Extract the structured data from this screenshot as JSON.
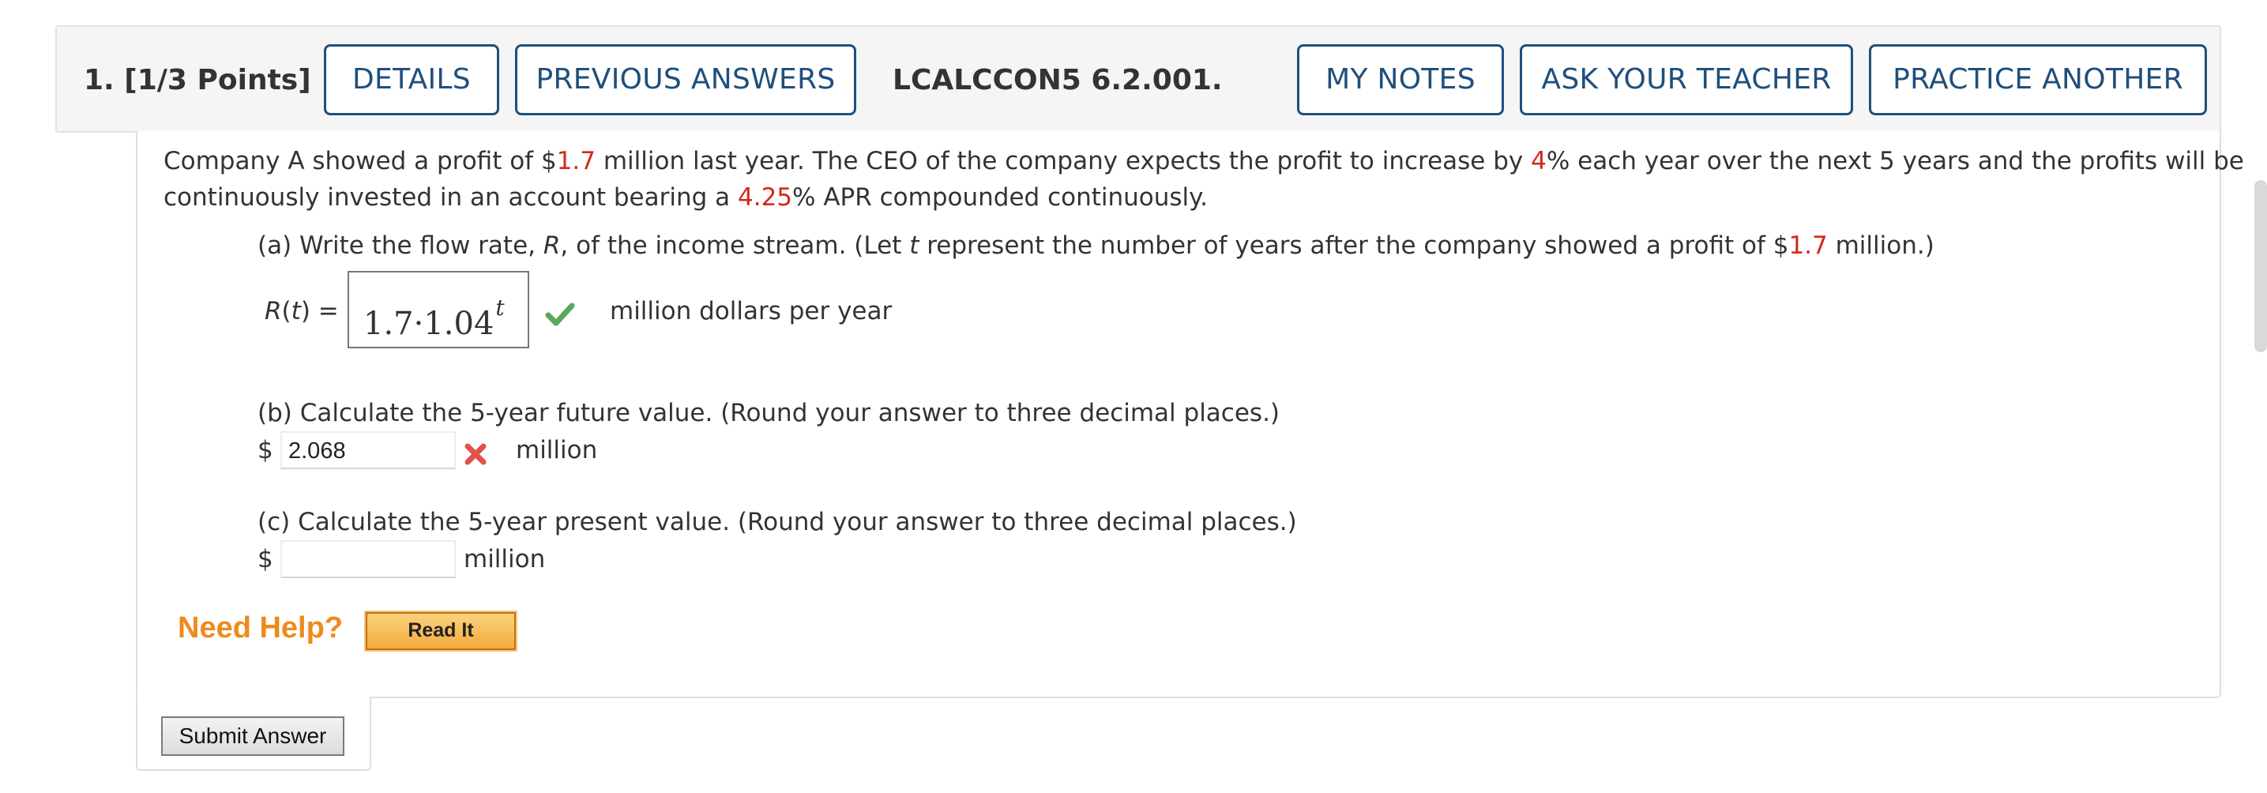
{
  "header": {
    "question_number": "1.",
    "points": "[1/3 Points]",
    "details_label": "DETAILS",
    "previous_answers_label": "PREVIOUS ANSWERS",
    "problem_code": "LCALCCON5 6.2.001.",
    "my_notes_label": "MY NOTES",
    "ask_teacher_label": "ASK YOUR TEACHER",
    "practice_another_label": "PRACTICE ANOTHER",
    "button_color": "#1f4f7d"
  },
  "intro": {
    "t1": "Company A showed a profit of $",
    "profit": "1.7",
    "t2": " million last year. The CEO of the company expects the profit to increase by ",
    "rate": "4",
    "t3": "% each year over the next 5 years and the profits will be",
    "t4": "continuously invested in an account bearing a ",
    "apr": "4.25",
    "t5": "% APR compounded continuously."
  },
  "part_a": {
    "q1": "(a) Write the flow rate, ",
    "q_R": "R",
    "q2": ", of the income stream. (Let ",
    "q_t": "t",
    "q3": " represent the number of years after the company showed a profit of $",
    "q_profit": "1.7",
    "q4": " million.)",
    "lhs_R": "R",
    "lhs_paren_open": "(",
    "lhs_t": "t",
    "lhs_rest": ") =",
    "answer_base": "1.7·1.04",
    "answer_exp": "t",
    "status_icon": "check-icon",
    "unit": "million dollars per year"
  },
  "part_b": {
    "question": "(b) Calculate the 5-year future value. (Round your answer to three decimal places.)",
    "currency": "$",
    "value": "2.068",
    "status_icon": "x-icon",
    "unit": "million"
  },
  "part_c": {
    "question": "(c) Calculate the 5-year present value. (Round your answer to three decimal places.)",
    "currency": "$",
    "value": "",
    "unit": "million"
  },
  "help": {
    "need_help": "Need Help?",
    "read_it": "Read It"
  },
  "submit_label": "Submit Answer",
  "colors": {
    "highlight_red": "#d5281b",
    "need_help_orange": "#ef8a1e",
    "check_green": "#5aa85a",
    "x_red": "#e0524a"
  }
}
